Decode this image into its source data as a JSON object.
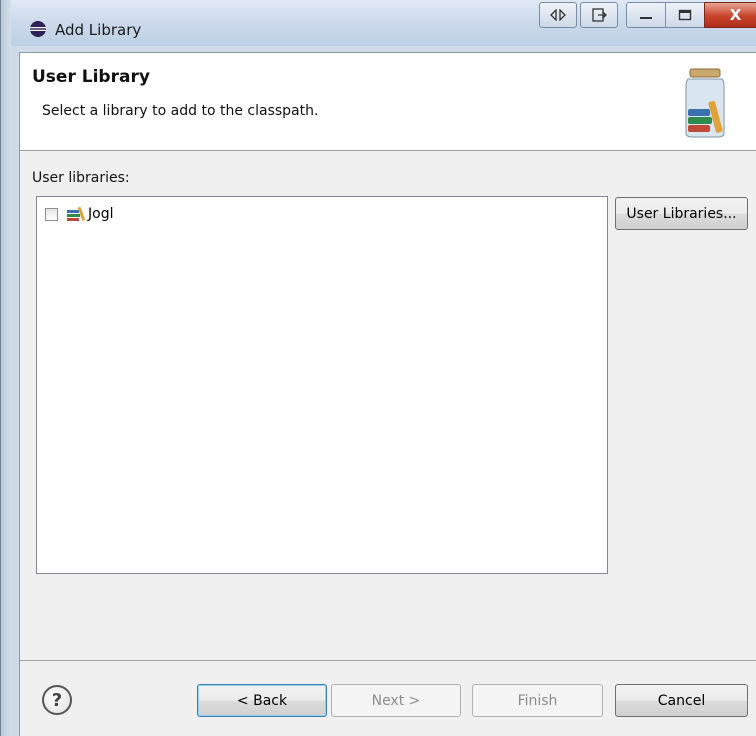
{
  "window": {
    "title": "Add Library",
    "app_icon": "eclipse-icon",
    "controls": {
      "swap_icon": "swap-icon",
      "move_icon": "move-icon",
      "minimize_icon": "minimize-icon",
      "maximize_icon": "maximize-icon",
      "close_label": "X"
    }
  },
  "header": {
    "title": "User Library",
    "description": "Select a library to add to the classpath.",
    "icon": "library-jar-icon"
  },
  "libraries": {
    "label": "User libraries:",
    "items": [
      {
        "name": "Jogl",
        "checked": false,
        "icon": "library-icon"
      }
    ],
    "manage_button": "User Libraries..."
  },
  "footer": {
    "help_label": "?",
    "back_label": "< Back",
    "next_label": "Next >",
    "finish_label": "Finish",
    "cancel_label": "Cancel"
  },
  "colors": {
    "titlebar": "#c9d8ea",
    "close_button": "#c7432a",
    "dialog_bg": "#f0f0f0",
    "default_button_border": "#3c7fb1"
  }
}
